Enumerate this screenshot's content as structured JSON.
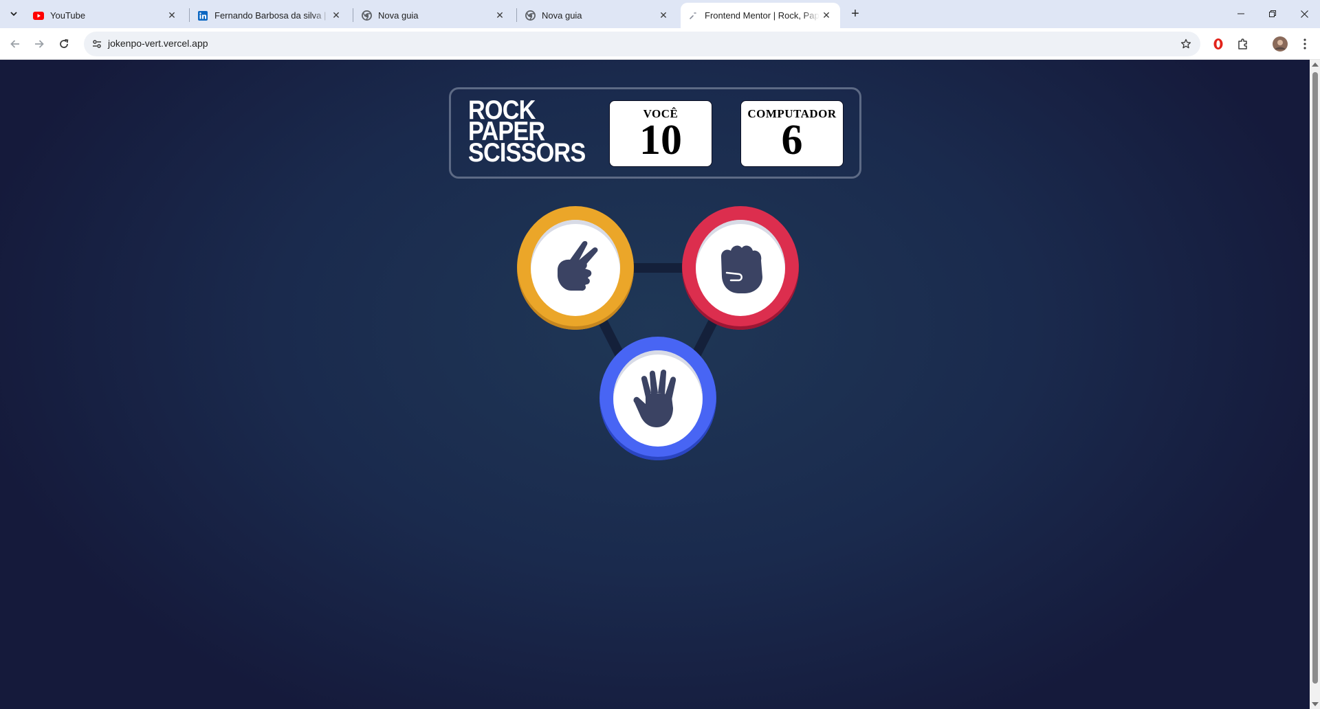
{
  "browser": {
    "tabs": [
      {
        "title": "YouTube",
        "icon": "youtube-icon",
        "active": false
      },
      {
        "title": "Fernando Barbosa da silva | LinkedIn",
        "icon": "linkedin-icon",
        "active": false
      },
      {
        "title": "Nova guia",
        "icon": "chrome-icon",
        "active": false
      },
      {
        "title": "Nova guia",
        "icon": "chrome-icon",
        "active": false
      },
      {
        "title": "Frontend Mentor | Rock, Paper, Scissors",
        "icon": "frontend-mentor-icon",
        "active": true
      }
    ],
    "url": "jokenpo-vert.vercel.app",
    "accent": "#dfe6f5"
  },
  "game": {
    "logo_lines": [
      "ROCK",
      "PAPER",
      "SCISSORS"
    ],
    "scores": {
      "player_label": "VOCÊ",
      "player_value": "10",
      "computer_label": "COMPUTADOR",
      "computer_value": "6"
    },
    "choices": [
      {
        "name": "scissors",
        "color": "#eba629"
      },
      {
        "name": "rock",
        "color": "#dc2e4e"
      },
      {
        "name": "paper",
        "color": "#4865f4"
      }
    ]
  }
}
